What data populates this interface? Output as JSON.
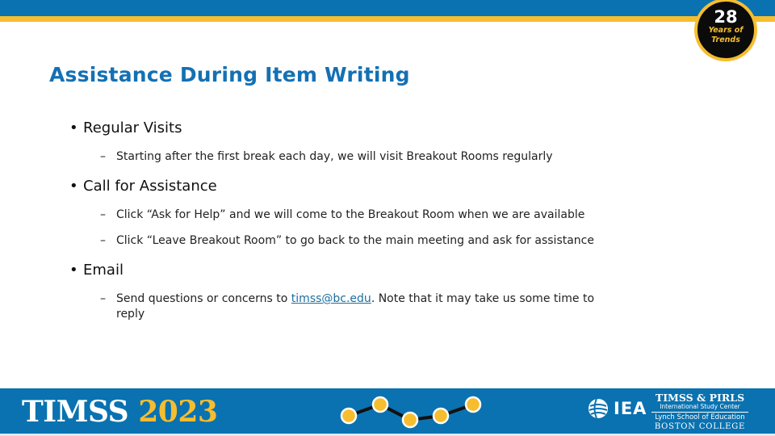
{
  "header": {
    "badge": {
      "number": "28",
      "line1": "Years of",
      "line2": "Trends"
    }
  },
  "slide": {
    "title": "Assistance During Item Writing",
    "sections": [
      {
        "heading": "Regular Visits",
        "items": [
          {
            "text": "Starting after the first break each day, we will visit Breakout Rooms regularly"
          }
        ]
      },
      {
        "heading": "Call for Assistance",
        "items": [
          {
            "text": "Click “Ask for Help” and we will come to the Breakout Room when we are available"
          },
          {
            "text": "Click “Leave Breakout Room” to go back to the main meeting and ask for assistance"
          }
        ]
      },
      {
        "heading": "Email",
        "items": [
          {
            "prefix": "Send questions or concerns to ",
            "link": "timss@bc.edu",
            "suffix": ". Note that it may take us some time to reply"
          }
        ]
      }
    ],
    "bullet_glyph": "•",
    "dash_glyph": "–"
  },
  "footer": {
    "brand_word": "TIMSS",
    "brand_year": "2023",
    "iea_label": "IEA",
    "center": {
      "line1": "TIMSS & PIRLS",
      "line2": "International Study Center",
      "line3": "Lynch School of Education",
      "line4": "BOSTON COLLEGE"
    }
  },
  "colors": {
    "brand_blue": "#0a72b0",
    "brand_yellow": "#f6bd2f",
    "title_blue": "#1470b4",
    "link": "#1c6fa0"
  }
}
